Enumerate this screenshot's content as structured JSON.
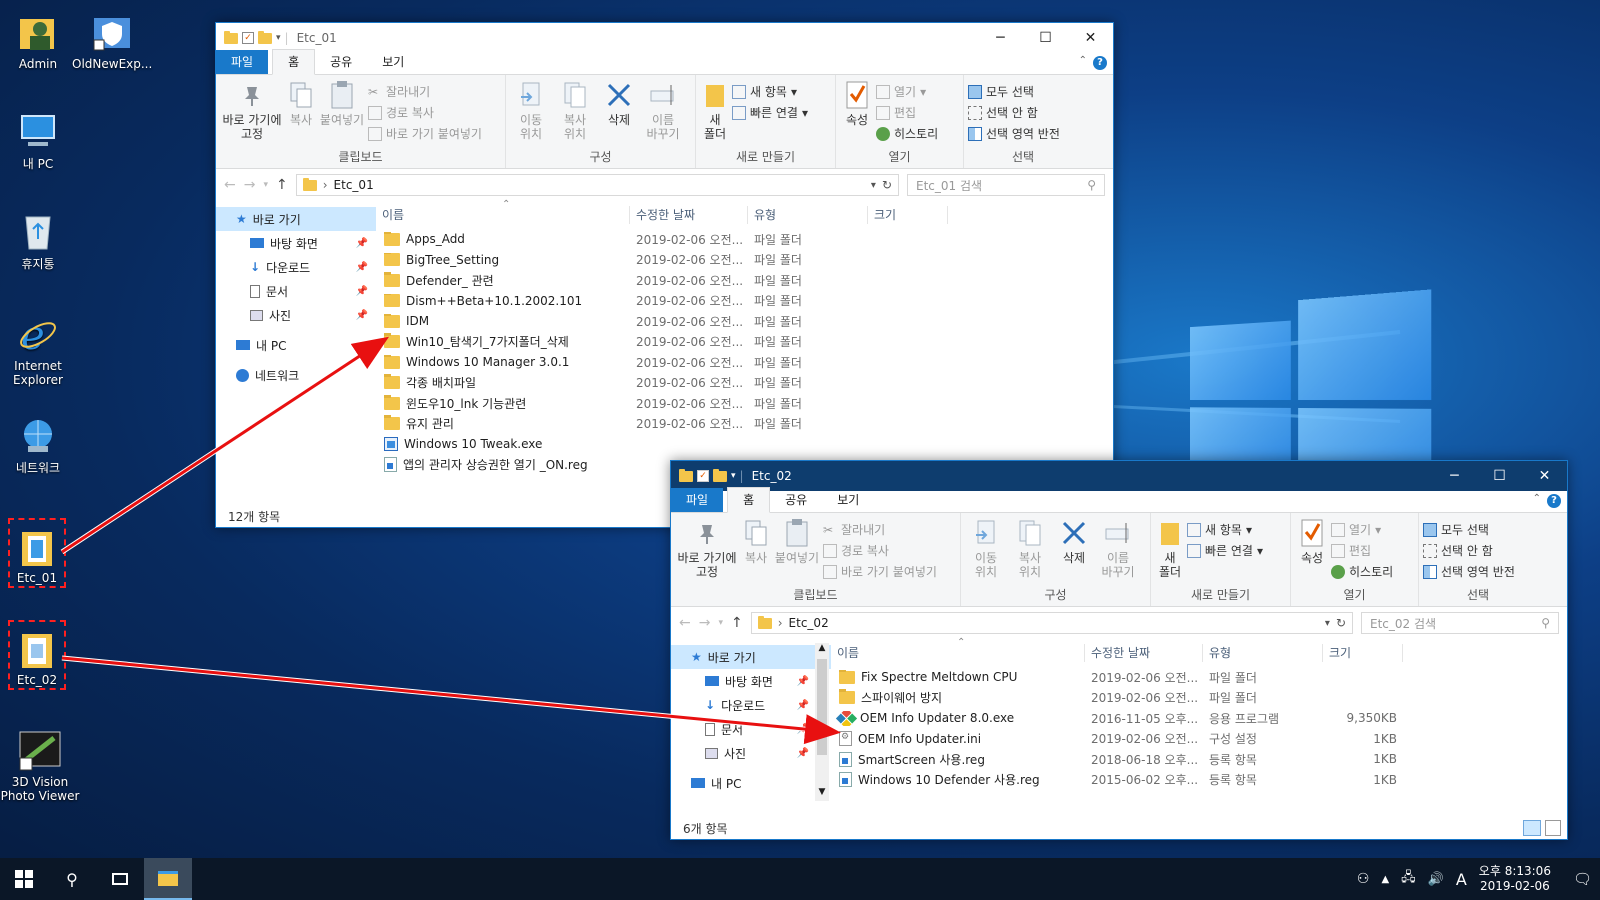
{
  "desktop": {
    "icons": [
      {
        "label": "Admin",
        "icon": "user-folder-icon"
      },
      {
        "label": "OldNewExp...",
        "icon": "shield-shortcut-icon"
      },
      {
        "label": "내 PC",
        "icon": "computer-icon"
      },
      {
        "label": "휴지통",
        "icon": "recycle-bin-icon"
      },
      {
        "label": "Internet\nExplorer",
        "icon": "internet-explorer-icon"
      },
      {
        "label": "네트워크",
        "icon": "network-icon"
      },
      {
        "label": "Etc_01",
        "icon": "folder-icon"
      },
      {
        "label": "Etc_02",
        "icon": "folder-icon"
      },
      {
        "label": "3D Vision\nPhoto Viewer",
        "icon": "photo-viewer-icon"
      }
    ],
    "arrow_color": "#e81010"
  },
  "ribbon": {
    "tabs": {
      "file": "파일",
      "home": "홈",
      "share": "공유",
      "view": "보기"
    },
    "clipboard": {
      "pin": "바로 가기에\n고정",
      "copy": "복사",
      "paste": "붙여넣기",
      "cut": "잘라내기",
      "copy_path": "경로 복사",
      "paste_shortcut": "바로 가기 붙여넣기",
      "group": "클립보드"
    },
    "organize": {
      "move": "이동\n위치",
      "copy_to": "복사\n위치",
      "delete": "삭제",
      "rename": "이름\n바꾸기",
      "group": "구성"
    },
    "new": {
      "new_folder": "새\n폴더",
      "new_item": "새 항목",
      "easy_access": "빠른 연결",
      "group": "새로 만들기"
    },
    "open": {
      "properties": "속성",
      "open": "열기",
      "edit": "편집",
      "history": "히스토리",
      "group": "열기"
    },
    "select": {
      "select_all": "모두 선택",
      "select_none": "선택 안 함",
      "invert": "선택 영역 반전",
      "group": "선택"
    }
  },
  "nav": {
    "quick_access": "바로 가기",
    "desktop": "바탕 화면",
    "downloads": "다운로드",
    "documents": "문서",
    "pictures": "사진",
    "this_pc": "내 PC",
    "network": "네트워크"
  },
  "columns": {
    "name": "이름",
    "modified": "수정한 날짜",
    "type": "유형",
    "size": "크기"
  },
  "window1": {
    "title": "Etc_01",
    "address": "Etc_01",
    "search_placeholder": "Etc_01 검색",
    "status": "12개 항목",
    "files": [
      {
        "name": "Apps_Add",
        "date": "2019-02-06 오전...",
        "type": "파일 폴더",
        "size": "",
        "icon": "folder"
      },
      {
        "name": "BigTree_Setting",
        "date": "2019-02-06 오전...",
        "type": "파일 폴더",
        "size": "",
        "icon": "folder"
      },
      {
        "name": "Defender_ 관련",
        "date": "2019-02-06 오전...",
        "type": "파일 폴더",
        "size": "",
        "icon": "folder"
      },
      {
        "name": "Dism++Beta+10.1.2002.101",
        "date": "2019-02-06 오전...",
        "type": "파일 폴더",
        "size": "",
        "icon": "folder"
      },
      {
        "name": "IDM",
        "date": "2019-02-06 오전...",
        "type": "파일 폴더",
        "size": "",
        "icon": "folder"
      },
      {
        "name": "Win10_탐색기_7가지폴더_삭제",
        "date": "2019-02-06 오전...",
        "type": "파일 폴더",
        "size": "",
        "icon": "folder"
      },
      {
        "name": "Windows 10 Manager 3.0.1",
        "date": "2019-02-06 오전...",
        "type": "파일 폴더",
        "size": "",
        "icon": "folder"
      },
      {
        "name": "각종 배치파일",
        "date": "2019-02-06 오전...",
        "type": "파일 폴더",
        "size": "",
        "icon": "folder"
      },
      {
        "name": "윈도우10_lnk 기능관련",
        "date": "2019-02-06 오전...",
        "type": "파일 폴더",
        "size": "",
        "icon": "folder"
      },
      {
        "name": "유지 관리",
        "date": "2019-02-06 오전...",
        "type": "파일 폴더",
        "size": "",
        "icon": "folder"
      },
      {
        "name": "Windows 10 Tweak.exe",
        "date": "",
        "type": "",
        "size": "",
        "icon": "exe"
      },
      {
        "name": "앱의 관리자 상승권한 열기 _ON.reg",
        "date": "",
        "type": "",
        "size": "",
        "icon": "reg"
      }
    ]
  },
  "window2": {
    "title": "Etc_02",
    "address": "Etc_02",
    "search_placeholder": "Etc_02 검색",
    "status": "6개 항목",
    "files": [
      {
        "name": "Fix Spectre Meltdown CPU",
        "date": "2019-02-06 오전...",
        "type": "파일 폴더",
        "size": "",
        "icon": "folder"
      },
      {
        "name": "스파이웨어 방지",
        "date": "2019-02-06 오전...",
        "type": "파일 폴더",
        "size": "",
        "icon": "folder"
      },
      {
        "name": "OEM Info Updater 8.0.exe",
        "date": "2016-11-05 오후...",
        "type": "응용 프로그램",
        "size": "9,350KB",
        "icon": "oem"
      },
      {
        "name": "OEM Info Updater.ini",
        "date": "2019-02-06 오전...",
        "type": "구성 설정",
        "size": "1KB",
        "icon": "ini"
      },
      {
        "name": "SmartScreen 사용.reg",
        "date": "2018-06-18 오후...",
        "type": "등록 항목",
        "size": "1KB",
        "icon": "reg"
      },
      {
        "name": "Windows 10 Defender 사용.reg",
        "date": "2015-06-02 오후...",
        "type": "등록 항목",
        "size": "1KB",
        "icon": "reg"
      }
    ]
  },
  "taskbar": {
    "time": "오후 8:13:06",
    "date": "2019-02-06",
    "ime": "A"
  }
}
